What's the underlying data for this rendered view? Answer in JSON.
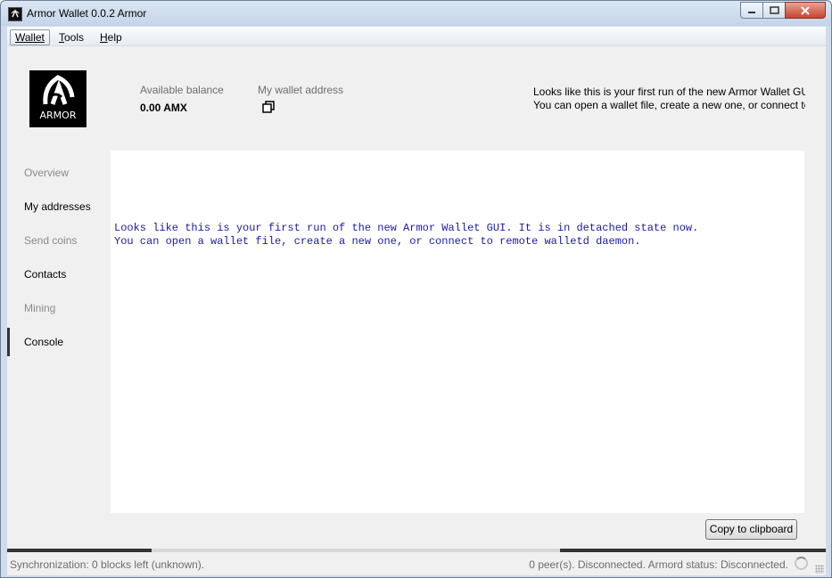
{
  "window": {
    "title": "Armor Wallet 0.0.2 Armor",
    "buttons": {
      "minimize": "minimize-icon",
      "maximize": "maximize-icon",
      "close": "close-icon"
    }
  },
  "menubar": {
    "items": [
      {
        "label": "Wallet",
        "accel": "W",
        "active": true
      },
      {
        "label": "Tools",
        "accel": "T"
      },
      {
        "label": "Help",
        "accel": "H"
      }
    ]
  },
  "header": {
    "logo_text": "ARMOR",
    "balance_label": "Available balance",
    "balance_value": "0.00 AMX",
    "address_label": "My wallet address",
    "copy_icon": "copy-icon",
    "notice": [
      "Looks like this is your first run of the new Armor Wallet GUI. It is in detached state now.",
      "You can open a wallet file, create a new one, or connect to remote walletd daemon."
    ]
  },
  "sidebar": {
    "items": [
      {
        "label": "Overview",
        "enabled": false
      },
      {
        "label": "My addresses",
        "enabled": true
      },
      {
        "label": "Send coins",
        "enabled": false
      },
      {
        "label": "Contacts",
        "enabled": true
      },
      {
        "label": "Mining",
        "enabled": false
      },
      {
        "label": "Console",
        "enabled": true,
        "selected": true
      }
    ]
  },
  "console": {
    "lines": [
      "Looks like this is your first run of the new Armor Wallet GUI. It is in detached state now.",
      "You can open a wallet file, create a new one, or connect to remote walletd daemon."
    ],
    "text_color": "#1a1aa6",
    "copy_button_label": "Copy to clipboard"
  },
  "statusbar": {
    "sync_text": "Synchronization: 0 blocks left (unknown).",
    "network_text": "0 peer(s).  Disconnected.  Armord status: Disconnected."
  }
}
